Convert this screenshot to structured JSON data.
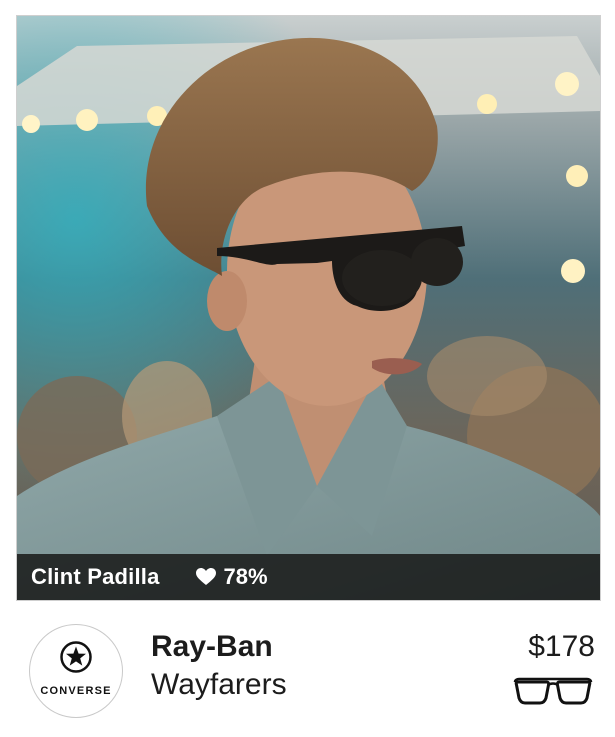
{
  "photo": {
    "person_name": "Clint Padilla",
    "like_percent": "78%",
    "icon": "heart-icon"
  },
  "product": {
    "brand_logo_text": "CONVERSE",
    "brand": "Ray-Ban",
    "model": "Wayfarers",
    "price": "$178",
    "category_icon": "glasses-icon"
  },
  "colors": {
    "caption_bg": "#141412",
    "text": "#1c1c1c",
    "border": "#cfcfcf"
  }
}
